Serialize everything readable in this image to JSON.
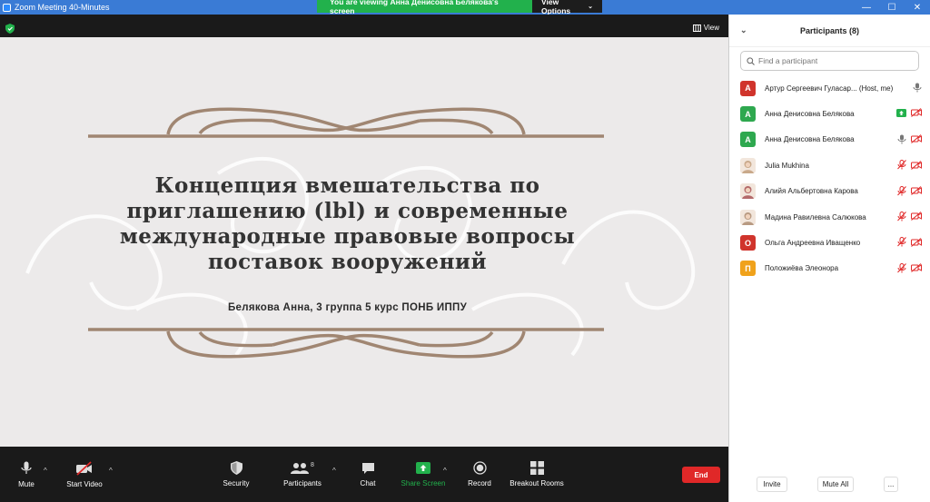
{
  "window": {
    "title": "Zoom Meeting 40-Minutes",
    "controls": {
      "minimize": "—",
      "maximize": "☐",
      "close": "✕"
    }
  },
  "banner": {
    "message": "You are viewing Анна Денисовна Белякова's screen",
    "view_options": "View Options"
  },
  "meeting": {
    "view_label": "View"
  },
  "slide": {
    "title": "Концепция вмешательства по приглашению (lbl) и современные международные правовые вопросы поставок вооружений",
    "subtitle": "Белякова Анна, 3 группа 5 курс ПОНБ ИППУ"
  },
  "toolbar": {
    "mute": "Mute",
    "start_video": "Start Video",
    "security": "Security",
    "participants": "Participants",
    "participants_count": "8",
    "chat": "Chat",
    "share_screen": "Share Screen",
    "record": "Record",
    "breakout_rooms": "Breakout Rooms",
    "end": "End"
  },
  "panel": {
    "title": "Participants (8)",
    "search_placeholder": "Find a participant",
    "participants": [
      {
        "initial": "А",
        "name": "Артур Сергеевич Гуласар... (Host, me)",
        "color": "#d0342c",
        "type": "letter",
        "video": "none",
        "mic": "on-gray"
      },
      {
        "initial": "А",
        "name": "Анна Денисовна Белякова",
        "color": "#2ea84f",
        "type": "letter",
        "video": "off",
        "mic": "sharing"
      },
      {
        "initial": "А",
        "name": "Анна Денисовна Белякова",
        "color": "#2ea84f",
        "type": "letter",
        "video": "off",
        "mic": "on-gray"
      },
      {
        "initial": "",
        "name": "Julia Mukhina",
        "color": "#c9a98a",
        "type": "photo",
        "video": "off",
        "mic": "muted"
      },
      {
        "initial": "",
        "name": "Алийя Альбертовна Карова",
        "color": "#b46a6a",
        "type": "photo",
        "video": "off",
        "mic": "muted"
      },
      {
        "initial": "",
        "name": "Мадина Равилевна Салюкова",
        "color": "#b89a82",
        "type": "photo",
        "video": "off",
        "mic": "muted"
      },
      {
        "initial": "О",
        "name": "Ольга Андреевна Иващенко",
        "color": "#d0342c",
        "type": "letter",
        "video": "off",
        "mic": "muted"
      },
      {
        "initial": "П",
        "name": "Положиёва Элеонора",
        "color": "#f0a21b",
        "type": "letter",
        "video": "off",
        "mic": "muted"
      }
    ],
    "invite": "Invite",
    "mute_all": "Mute All",
    "more": "..."
  },
  "colors": {
    "accent_green": "#22b14c",
    "end_red": "#e02828",
    "slide_ornament": "#a08672"
  }
}
